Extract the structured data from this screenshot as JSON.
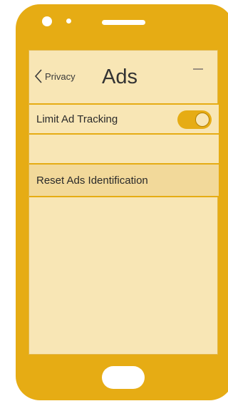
{
  "nav": {
    "back_label": "Privacy",
    "title": "Ads"
  },
  "settings": {
    "limit_ad_tracking_label": "Limit Ad Tracking",
    "limit_ad_tracking_on": true,
    "reset_label": "Reset Ads Identification"
  },
  "icons": {
    "back": "chevron-left-icon"
  },
  "colors": {
    "phone_body": "#e6ac14",
    "screen_bg": "#f8e6b5",
    "highlight_row": "#f2d99a",
    "toggle_on": "#e6ac14"
  }
}
